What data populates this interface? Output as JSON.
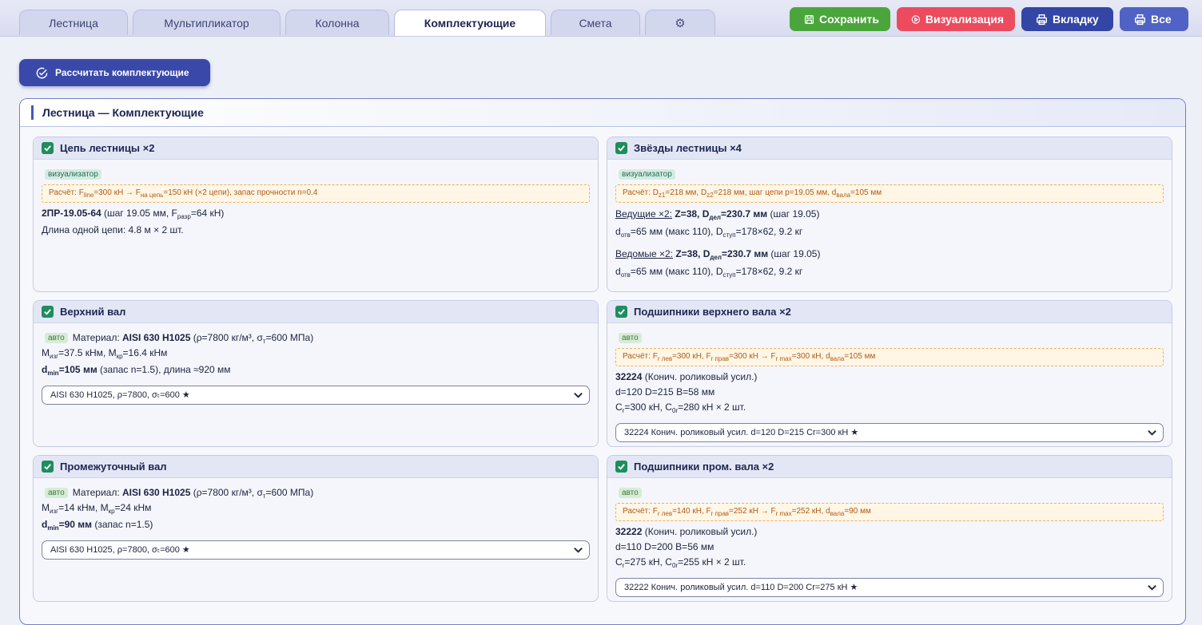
{
  "tabs": [
    {
      "label": "Лестница"
    },
    {
      "label": "Мультипликатор"
    },
    {
      "label": "Колонна"
    },
    {
      "label": "Комплектующие"
    },
    {
      "label": "Смета"
    }
  ],
  "actions": {
    "save": "Сохранить",
    "visualize": "Визуализация",
    "tab": "Вкладку",
    "all": "Все"
  },
  "calc_button": "Рассчитать комплектующие",
  "section_title": "Лестница — Комплектующие",
  "colors": {
    "accent": "#3a48a9",
    "check": "#1f8d5c",
    "save": "#4aa63b",
    "visualize": "#ec4b5e"
  },
  "cards": {
    "chain": {
      "title": "Цепь лестницы ×2",
      "tag": "визуализатор",
      "calc": {
        "p1": "Расчёт: F",
        "s1": "line",
        "p2": "=300 кН → F",
        "s2": "на цепь",
        "p3": "=150 кН (×2 цепи), запас прочности n=0.4"
      },
      "l1": {
        "name": "2ПР-19.05-64",
        "p1": " (шаг 19.05 мм, F",
        "s1": "разр",
        "p2": "=64 кН)"
      },
      "l2": "Длина одной цепи: 4.8 м × 2 шт."
    },
    "sprockets": {
      "title": "Звёзды лестницы ×4",
      "tag": "визуализатор",
      "calc": {
        "p1": "Расчёт: D",
        "s1": "z1",
        "p2": "=218 мм, D",
        "s2": "z2",
        "p3": "=218 мм, шаг цепи p=19.05 мм, d",
        "s3": "вала",
        "p4": "=105 мм"
      },
      "drive": {
        "label": "Ведущие ×2:",
        "b1": " Z=38, D",
        "bs": "дел",
        "b2": "=230.7 мм",
        "rest": " (шаг 19.05)"
      },
      "drive2": {
        "p1": "d",
        "s1": "отв",
        "p2": "=65 мм (макс 110), D",
        "s2": "ступ",
        "p3": "=178×62, 9.2 кг"
      },
      "driven": {
        "label": "Ведомые ×2:",
        "b1": " Z=38, D",
        "bs": "дел",
        "b2": "=230.7 мм",
        "rest": " (шаг 19.05)"
      },
      "driven2": {
        "p1": "d",
        "s1": "отв",
        "p2": "=65 мм (макс 110), D",
        "s2": "ступ",
        "p3": "=178×62, 9.2 кг"
      }
    },
    "upper_shaft": {
      "title": "Верхний вал",
      "tag": "авто",
      "mat": {
        "p1": "Материал: ",
        "b": "AISI 630 H1025",
        "p2": " (ρ=7800 кг/м³, σ",
        "s": "т",
        "p3": "=600 МПа)"
      },
      "m": {
        "p1": "M",
        "s1": "изг",
        "p2": "=37.5 кНм, M",
        "s2": "кр",
        "p3": "=16.4 кНм"
      },
      "d": {
        "b1": "d",
        "bs": "min",
        "b2": "=105 мм",
        "rest": " (запас n=1.5), длина ≈920 мм"
      },
      "select": "AISI 630 H1025, ρ=7800, σₜ=600 ★"
    },
    "upper_bearings": {
      "title": "Подшипники верхнего вала ×2",
      "tag": "авто",
      "calc": {
        "p1": "Расчёт: F",
        "s1": "r лев",
        "p2": "=300 кН, F",
        "s2": "r прав",
        "p3": "=300 кН → F",
        "s3": "r max",
        "p4": "=300 кН, d",
        "s4": "вала",
        "p5": "=105 мм"
      },
      "l1": {
        "b": "32224",
        "rest": " (Конич. роликовый усил.)"
      },
      "l2": "d=120 D=215 B=58 мм",
      "l3": {
        "p1": "C",
        "s1": "r",
        "p2": "=300 кН, C",
        "s2": "0r",
        "p3": "=280 кН × 2 шт."
      },
      "select": "32224 Конич. роликовый усил. d=120 D=215 Cr=300 кН ★"
    },
    "mid_shaft": {
      "title": "Промежуточный вал",
      "tag": "авто",
      "mat": {
        "p1": "Материал: ",
        "b": "AISI 630 H1025",
        "p2": " (ρ=7800 кг/м³, σ",
        "s": "т",
        "p3": "=600 МПа)"
      },
      "m": {
        "p1": "M",
        "s1": "изг",
        "p2": "=14 кНм, M",
        "s2": "кр",
        "p3": "=24 кНм"
      },
      "d": {
        "b1": "d",
        "bs": "min",
        "b2": "=90 мм",
        "rest": " (запас n=1.5)"
      },
      "select": "AISI 630 H1025, ρ=7800, σₜ=600 ★"
    },
    "mid_bearings": {
      "title": "Подшипники пром. вала ×2",
      "tag": "авто",
      "calc": {
        "p1": "Расчёт: F",
        "s1": "r лев",
        "p2": "=140 кН, F",
        "s2": "r прав",
        "p3": "=252 кН → F",
        "s3": "r max",
        "p4": "=252 кН, d",
        "s4": "вала",
        "p5": "=90 мм"
      },
      "l1": {
        "b": "32222",
        "rest": " (Конич. роликовый усил.)"
      },
      "l2": "d=110 D=200 B=56 мм",
      "l3": {
        "p1": "C",
        "s1": "r",
        "p2": "=275 кН, C",
        "s2": "0r",
        "p3": "=255 кН × 2 шт."
      },
      "select": "32222 Конич. роликовый усил. d=110 D=200 Cr=275 кН ★"
    }
  }
}
